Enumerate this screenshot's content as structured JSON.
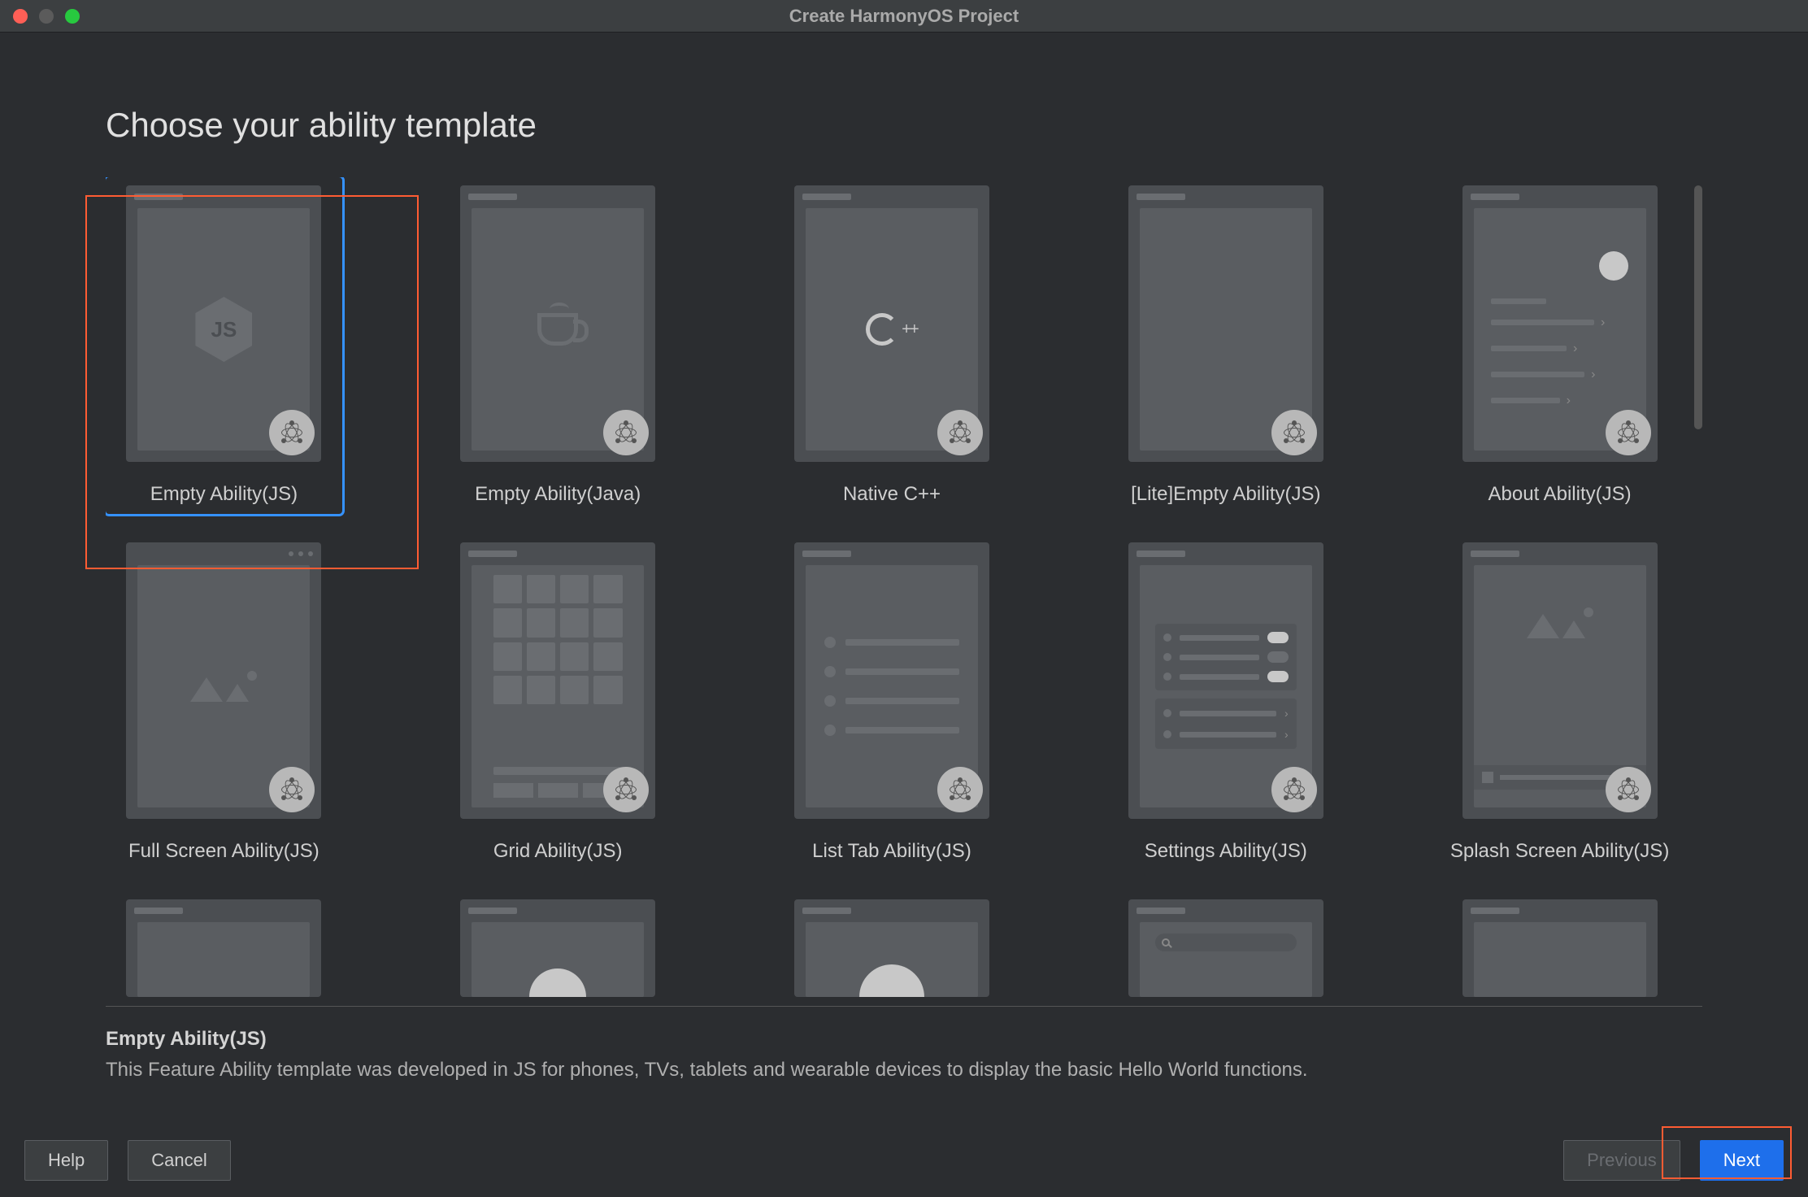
{
  "window": {
    "title": "Create HarmonyOS Project"
  },
  "heading": "Choose your ability template",
  "templates": [
    {
      "label": "Empty Ability(JS)",
      "kind": "js",
      "selected": true
    },
    {
      "label": "Empty Ability(Java)",
      "kind": "java",
      "selected": false
    },
    {
      "label": "Native C++",
      "kind": "cpp",
      "selected": false
    },
    {
      "label": "[Lite]Empty Ability(JS)",
      "kind": "lite",
      "selected": false
    },
    {
      "label": "About Ability(JS)",
      "kind": "about",
      "selected": false
    },
    {
      "label": "Full Screen Ability(JS)",
      "kind": "fullscreen",
      "selected": false
    },
    {
      "label": "Grid Ability(JS)",
      "kind": "grid",
      "selected": false
    },
    {
      "label": "List Tab Ability(JS)",
      "kind": "list",
      "selected": false
    },
    {
      "label": "Settings Ability(JS)",
      "kind": "settings",
      "selected": false
    },
    {
      "label": "Splash Screen Ability(JS)",
      "kind": "splash",
      "selected": false
    }
  ],
  "partial_row_kinds": [
    "blank",
    "tab",
    "profile",
    "search",
    "blank2"
  ],
  "description": {
    "title": "Empty Ability(JS)",
    "text": "This Feature Ability template was developed in JS for phones, TVs, tablets and wearable devices to display the basic Hello World functions."
  },
  "buttons": {
    "help": "Help",
    "cancel": "Cancel",
    "previous": "Previous",
    "next": "Next"
  },
  "icons": {
    "js_label": "JS",
    "cpp_plus": "++"
  },
  "colors": {
    "accent": "#1e6feb",
    "highlight": "#ff5c33",
    "select": "#3592ff"
  }
}
